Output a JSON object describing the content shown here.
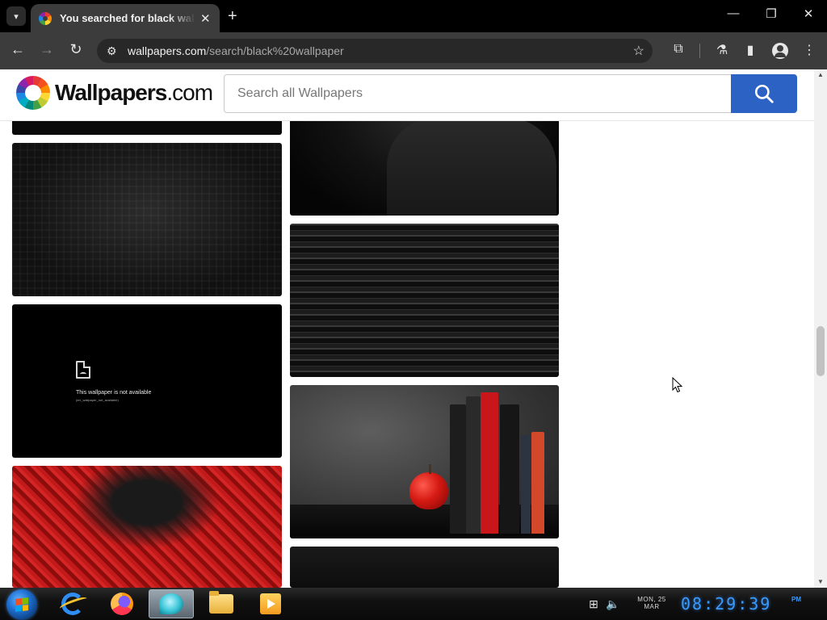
{
  "browser": {
    "tab_title": "You searched for black wallpaper",
    "tab_close": "✕",
    "new_tab": "+",
    "url_host": "wallpapers.com",
    "url_path": "/search/black%20wallpaper",
    "window_controls": {
      "minimize": "—",
      "restore": "❐",
      "close": "✕"
    },
    "icons": [
      "tab-search-icon",
      "back-icon",
      "forward-icon",
      "reload-icon",
      "site-info-icon",
      "bookmark-star-icon",
      "extensions-icon",
      "labs-icon",
      "side-panel-icon",
      "profile-icon",
      "menu-icon"
    ]
  },
  "site": {
    "logo_main": "Wallpapers",
    "logo_suffix": ".com",
    "search_placeholder": "Search all Wallpapers",
    "search_icon": "search-icon",
    "accent_color": "#2c62c4"
  },
  "results": {
    "unavailable_message": "This wallpaper is not available",
    "unavailable_sub": "(err_wallpaper_not_available)"
  },
  "taskbar": {
    "apps": [
      "internet-explorer",
      "firefox",
      "chat-app",
      "file-explorer",
      "media-player"
    ],
    "date_line1": "MON, 25",
    "date_line2": "MAR",
    "clock": "08:29:39",
    "ampm": "PM"
  }
}
